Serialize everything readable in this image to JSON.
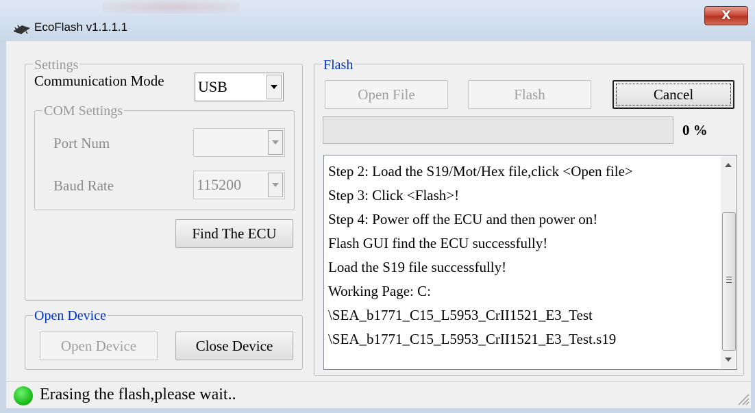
{
  "window": {
    "title": "EcoFlash v1.1.1.1",
    "close_glyph": "X",
    "app_icon": "chip-icon"
  },
  "settings": {
    "legend": "Settings",
    "comm_mode_label": "Communication Mode",
    "comm_mode_value": "USB",
    "com_settings": {
      "legend": "COM Settings",
      "port_num_label": "Port Num",
      "port_num_value": "",
      "baud_rate_label": "Baud Rate",
      "baud_rate_value": "115200"
    },
    "find_ecu_label": "Find The ECU"
  },
  "open_device": {
    "legend": "Open Device",
    "open_label": "Open Device",
    "close_label": "Close Device"
  },
  "flash": {
    "legend": "Flash",
    "open_file_label": "Open File",
    "flash_label": "Flash",
    "cancel_label": "Cancel",
    "progress_percent": 0,
    "progress_text": "0 %",
    "log_lines": [
      "Step 2: Load the S19/Mot/Hex file,click <Open file>",
      "Step 3: Click <Flash>!",
      "Step 4: Power off the ECU and then power on!",
      "Flash GUI find the ECU successfully!",
      "Load the S19 file successfully!",
      "Working Page: C:",
      "\\SEA_b1771_C15_L5953_CrII1521_E3_Test",
      "\\SEA_b1771_C15_L5953_CrII1521_E3_Test.s19"
    ]
  },
  "status": {
    "text": "Erasing the flash,please wait..",
    "indicator_color": "#1fbf1f"
  },
  "colors": {
    "group_legend_blue": "#0033cc",
    "disabled_text": "#9e9e9e"
  }
}
